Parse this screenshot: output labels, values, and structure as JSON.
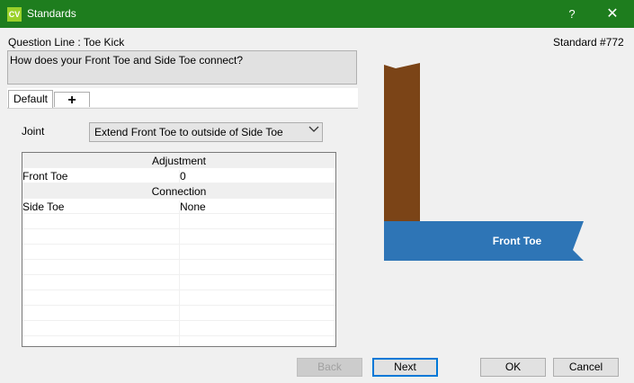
{
  "window": {
    "title": "Standards",
    "app_icon_text": "CV",
    "help_glyph": "?",
    "close_glyph": "✕"
  },
  "header": {
    "question_line": "Question Line : Toe Kick",
    "standard_number": "Standard #772",
    "question": "How does your Front Toe and Side Toe connect?"
  },
  "tabs": [
    {
      "label": "Default",
      "active": true
    },
    {
      "label": "+",
      "active": false
    }
  ],
  "joint": {
    "label": "Joint",
    "selected": "Extend Front Toe to outside of Side Toe"
  },
  "grid": {
    "rows": [
      {
        "type": "section",
        "label": "Adjustment"
      },
      {
        "type": "row",
        "name": "Front Toe",
        "value": "0"
      },
      {
        "type": "section",
        "label": "Connection"
      },
      {
        "type": "row",
        "name": "Side Toe",
        "value": "None"
      }
    ]
  },
  "illustration": {
    "label": "Front Toe",
    "side_color": "#7b4417",
    "front_color": "#2e75b6"
  },
  "buttons": {
    "back": "Back",
    "next": "Next",
    "ok": "OK",
    "cancel": "Cancel"
  }
}
